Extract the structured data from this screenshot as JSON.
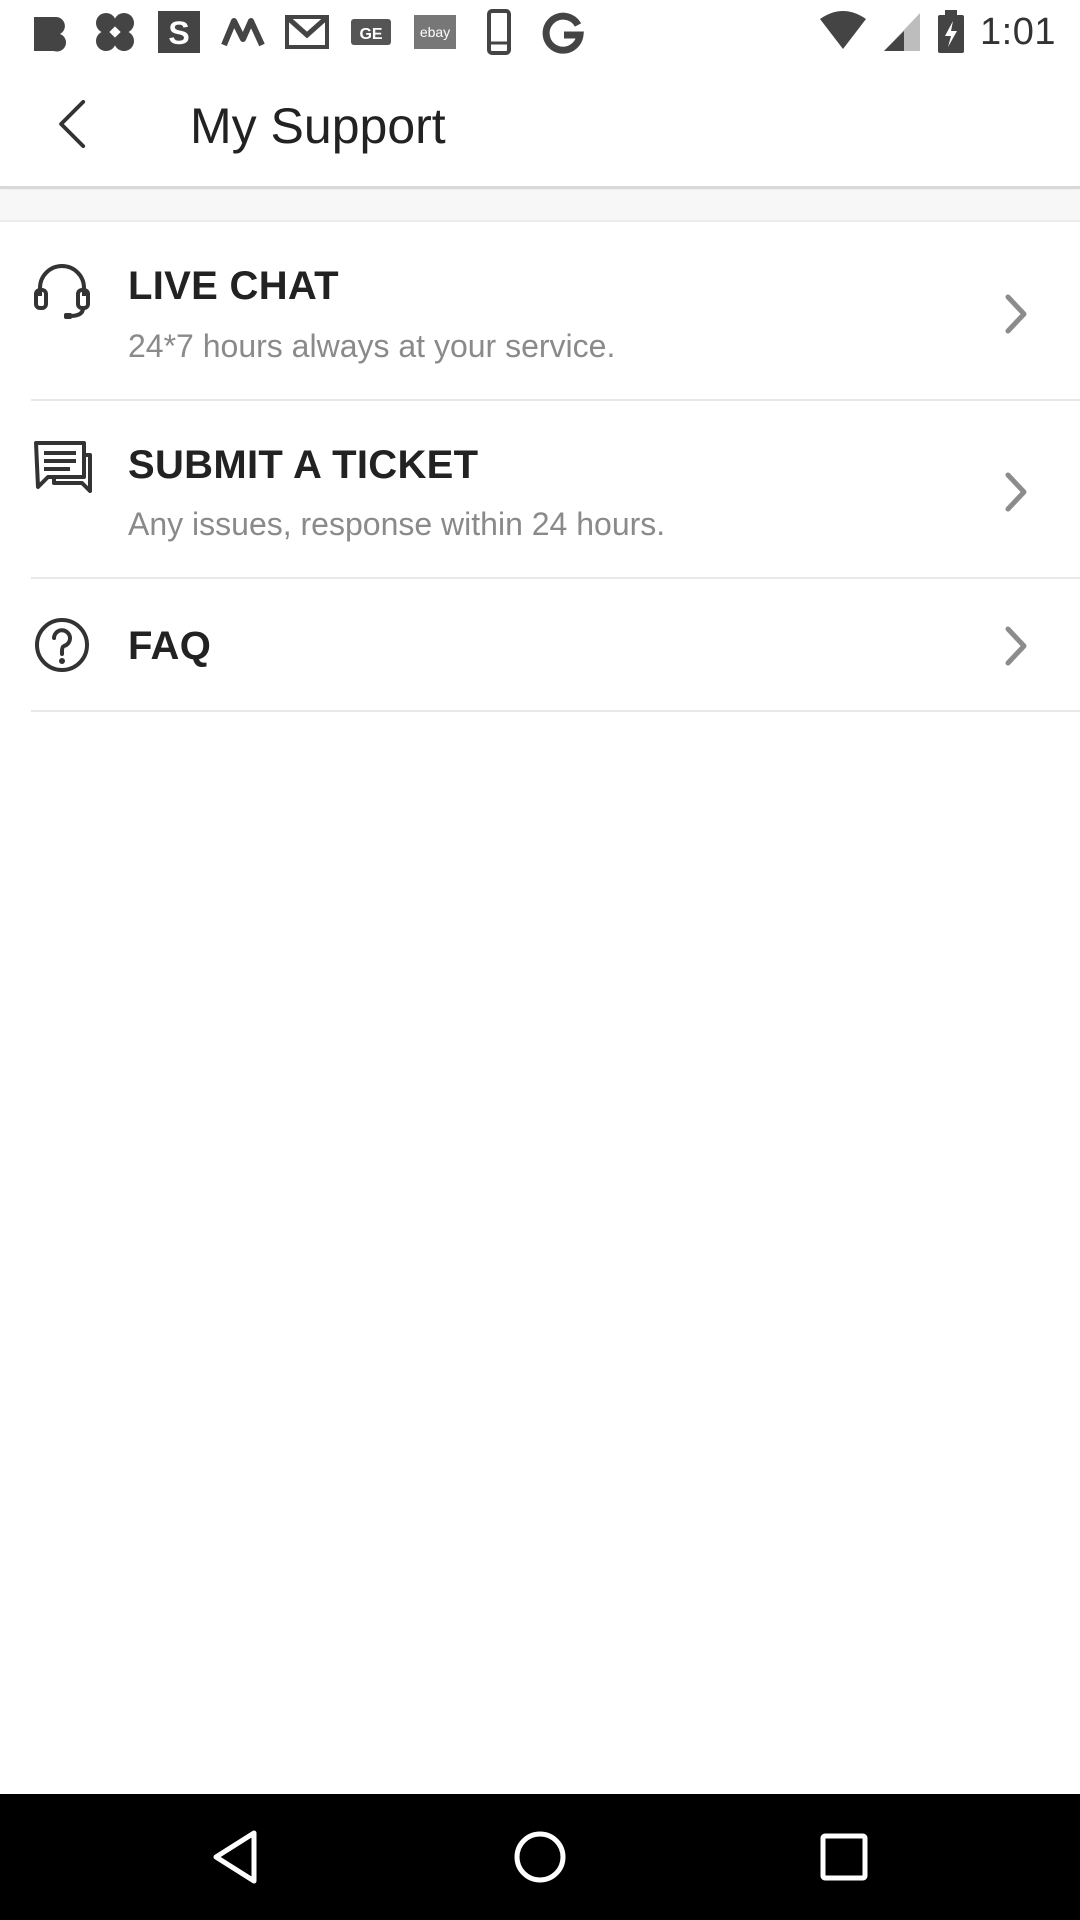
{
  "status_bar": {
    "time": "1:01",
    "notification_icons": [
      "beats-b-icon",
      "four-petal-app-icon",
      "s-square-icon",
      "m-logo-icon",
      "gmail-icon",
      "ge-badge-icon",
      "ebay-badge-icon",
      "phone-outline-icon",
      "google-g-icon"
    ],
    "ebay_label": "ebay",
    "ge_label": "GE",
    "system_icons": [
      "wifi-icon",
      "cell-signal-icon",
      "battery-charging-icon"
    ]
  },
  "app_bar": {
    "title": "My Support",
    "back_icon": "back-chevron-icon"
  },
  "support_items": [
    {
      "icon": "headset-icon",
      "title": "LIVE CHAT",
      "subtitle": "24*7 hours always at your service."
    },
    {
      "icon": "chat-bubble-icon",
      "title": "SUBMIT A TICKET",
      "subtitle": "Any issues, response within 24 hours."
    },
    {
      "icon": "help-circle-icon",
      "title": "FAQ",
      "subtitle": ""
    }
  ],
  "nav_bar": {
    "buttons": [
      "back-triangle-icon",
      "home-circle-icon",
      "recents-square-icon"
    ]
  },
  "colors": {
    "title_text": "#222222",
    "subtitle_text": "#8a8a8a",
    "chevron": "#8c8c8c",
    "divider": "#e8e8e8",
    "nav_bar": "#000000"
  }
}
